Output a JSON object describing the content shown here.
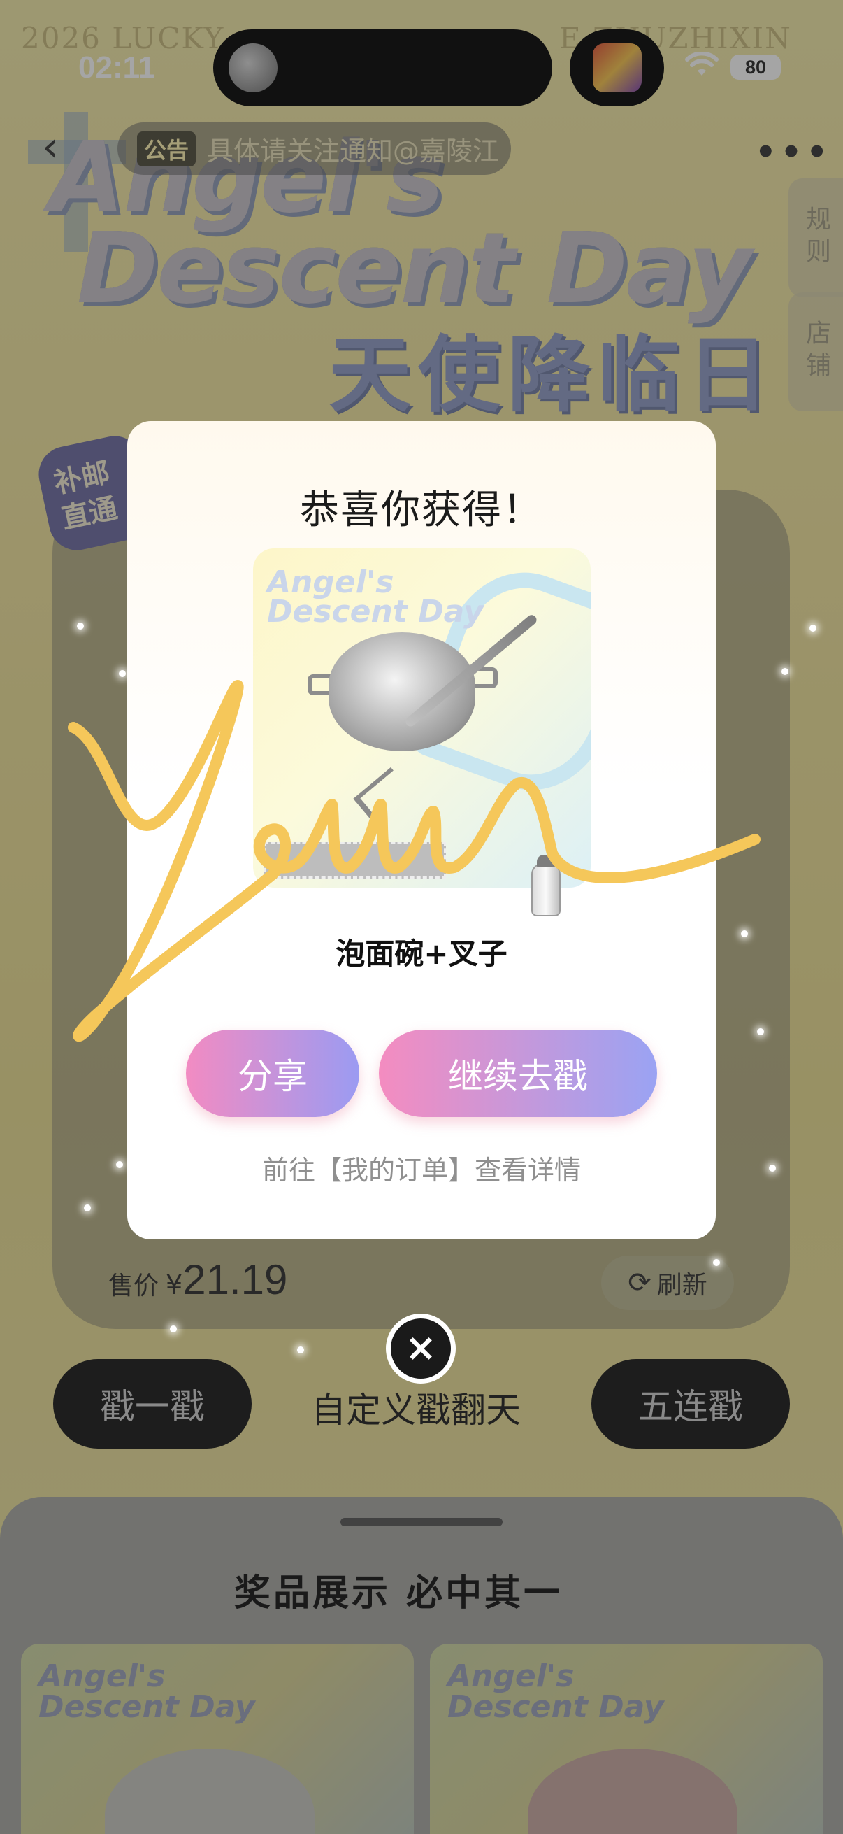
{
  "status_bar": {
    "time": "02:11",
    "battery": "80"
  },
  "watermark": {
    "left": "2026 LUCKY",
    "right": "E  ZHUZHIXIN"
  },
  "nav": {
    "notice_tag": "公告",
    "notice_text": "具体请关注通知@嘉陵江"
  },
  "side_tabs": {
    "rules": "规则",
    "shop": "店铺"
  },
  "hero": {
    "title_en_line1": "Angel's",
    "title_en_line2": "Descent Day",
    "title_cn": "天使降临日"
  },
  "corner_badge": "补邮\n直通",
  "modal": {
    "title": "恭喜你获得！",
    "prize_image_brand": "Angel's\nDescent Day",
    "prize_name": "泡面碗+叉子",
    "share_button": "分享",
    "continue_button": "继续去戳",
    "orders_hint": "前往【我的订单】查看详情"
  },
  "purchase": {
    "price_label": "售价",
    "currency": "¥",
    "price": "21.19",
    "refresh_label": "刷新"
  },
  "actions": {
    "poke_once": "戳一戳",
    "custom_poke": "自定义戳翻天",
    "poke_five": "五连戳"
  },
  "prizes_sheet": {
    "title": "奖品展示 必中其一",
    "card_brand": "Angel's\nDescent Day"
  },
  "colors": {
    "accent_pink": "#f28bc2",
    "accent_blue": "#9aa3f3",
    "signature_yellow": "#f5c75a"
  }
}
